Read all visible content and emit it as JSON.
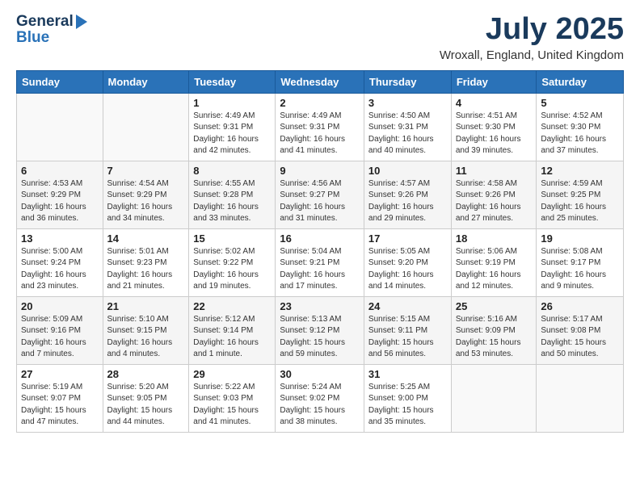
{
  "header": {
    "logo_line1": "General",
    "logo_line2": "Blue",
    "month": "July 2025",
    "location": "Wroxall, England, United Kingdom"
  },
  "weekdays": [
    "Sunday",
    "Monday",
    "Tuesday",
    "Wednesday",
    "Thursday",
    "Friday",
    "Saturday"
  ],
  "weeks": [
    [
      {
        "day": "",
        "info": ""
      },
      {
        "day": "",
        "info": ""
      },
      {
        "day": "1",
        "info": "Sunrise: 4:49 AM\nSunset: 9:31 PM\nDaylight: 16 hours and 42 minutes."
      },
      {
        "day": "2",
        "info": "Sunrise: 4:49 AM\nSunset: 9:31 PM\nDaylight: 16 hours and 41 minutes."
      },
      {
        "day": "3",
        "info": "Sunrise: 4:50 AM\nSunset: 9:31 PM\nDaylight: 16 hours and 40 minutes."
      },
      {
        "day": "4",
        "info": "Sunrise: 4:51 AM\nSunset: 9:30 PM\nDaylight: 16 hours and 39 minutes."
      },
      {
        "day": "5",
        "info": "Sunrise: 4:52 AM\nSunset: 9:30 PM\nDaylight: 16 hours and 37 minutes."
      }
    ],
    [
      {
        "day": "6",
        "info": "Sunrise: 4:53 AM\nSunset: 9:29 PM\nDaylight: 16 hours and 36 minutes."
      },
      {
        "day": "7",
        "info": "Sunrise: 4:54 AM\nSunset: 9:29 PM\nDaylight: 16 hours and 34 minutes."
      },
      {
        "day": "8",
        "info": "Sunrise: 4:55 AM\nSunset: 9:28 PM\nDaylight: 16 hours and 33 minutes."
      },
      {
        "day": "9",
        "info": "Sunrise: 4:56 AM\nSunset: 9:27 PM\nDaylight: 16 hours and 31 minutes."
      },
      {
        "day": "10",
        "info": "Sunrise: 4:57 AM\nSunset: 9:26 PM\nDaylight: 16 hours and 29 minutes."
      },
      {
        "day": "11",
        "info": "Sunrise: 4:58 AM\nSunset: 9:26 PM\nDaylight: 16 hours and 27 minutes."
      },
      {
        "day": "12",
        "info": "Sunrise: 4:59 AM\nSunset: 9:25 PM\nDaylight: 16 hours and 25 minutes."
      }
    ],
    [
      {
        "day": "13",
        "info": "Sunrise: 5:00 AM\nSunset: 9:24 PM\nDaylight: 16 hours and 23 minutes."
      },
      {
        "day": "14",
        "info": "Sunrise: 5:01 AM\nSunset: 9:23 PM\nDaylight: 16 hours and 21 minutes."
      },
      {
        "day": "15",
        "info": "Sunrise: 5:02 AM\nSunset: 9:22 PM\nDaylight: 16 hours and 19 minutes."
      },
      {
        "day": "16",
        "info": "Sunrise: 5:04 AM\nSunset: 9:21 PM\nDaylight: 16 hours and 17 minutes."
      },
      {
        "day": "17",
        "info": "Sunrise: 5:05 AM\nSunset: 9:20 PM\nDaylight: 16 hours and 14 minutes."
      },
      {
        "day": "18",
        "info": "Sunrise: 5:06 AM\nSunset: 9:19 PM\nDaylight: 16 hours and 12 minutes."
      },
      {
        "day": "19",
        "info": "Sunrise: 5:08 AM\nSunset: 9:17 PM\nDaylight: 16 hours and 9 minutes."
      }
    ],
    [
      {
        "day": "20",
        "info": "Sunrise: 5:09 AM\nSunset: 9:16 PM\nDaylight: 16 hours and 7 minutes."
      },
      {
        "day": "21",
        "info": "Sunrise: 5:10 AM\nSunset: 9:15 PM\nDaylight: 16 hours and 4 minutes."
      },
      {
        "day": "22",
        "info": "Sunrise: 5:12 AM\nSunset: 9:14 PM\nDaylight: 16 hours and 1 minute."
      },
      {
        "day": "23",
        "info": "Sunrise: 5:13 AM\nSunset: 9:12 PM\nDaylight: 15 hours and 59 minutes."
      },
      {
        "day": "24",
        "info": "Sunrise: 5:15 AM\nSunset: 9:11 PM\nDaylight: 15 hours and 56 minutes."
      },
      {
        "day": "25",
        "info": "Sunrise: 5:16 AM\nSunset: 9:09 PM\nDaylight: 15 hours and 53 minutes."
      },
      {
        "day": "26",
        "info": "Sunrise: 5:17 AM\nSunset: 9:08 PM\nDaylight: 15 hours and 50 minutes."
      }
    ],
    [
      {
        "day": "27",
        "info": "Sunrise: 5:19 AM\nSunset: 9:07 PM\nDaylight: 15 hours and 47 minutes."
      },
      {
        "day": "28",
        "info": "Sunrise: 5:20 AM\nSunset: 9:05 PM\nDaylight: 15 hours and 44 minutes."
      },
      {
        "day": "29",
        "info": "Sunrise: 5:22 AM\nSunset: 9:03 PM\nDaylight: 15 hours and 41 minutes."
      },
      {
        "day": "30",
        "info": "Sunrise: 5:24 AM\nSunset: 9:02 PM\nDaylight: 15 hours and 38 minutes."
      },
      {
        "day": "31",
        "info": "Sunrise: 5:25 AM\nSunset: 9:00 PM\nDaylight: 15 hours and 35 minutes."
      },
      {
        "day": "",
        "info": ""
      },
      {
        "day": "",
        "info": ""
      }
    ]
  ]
}
